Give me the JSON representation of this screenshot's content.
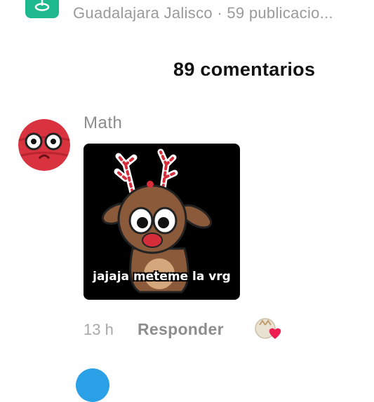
{
  "header": {
    "location_text": "Guadalajara Jalisco · 59 publicacio...",
    "location_icon": "map-pin-icon",
    "accent": "#1db88e"
  },
  "comments": {
    "count_label": "89 comentarios",
    "items": [
      {
        "author": "Math",
        "avatar_icon": "worried-face-avatar",
        "sticker_caption": "jajaja meteme la vrg",
        "time": "13 h",
        "reply_label": "Responder",
        "reaction_icon": "heart-reaction-icon"
      }
    ]
  }
}
